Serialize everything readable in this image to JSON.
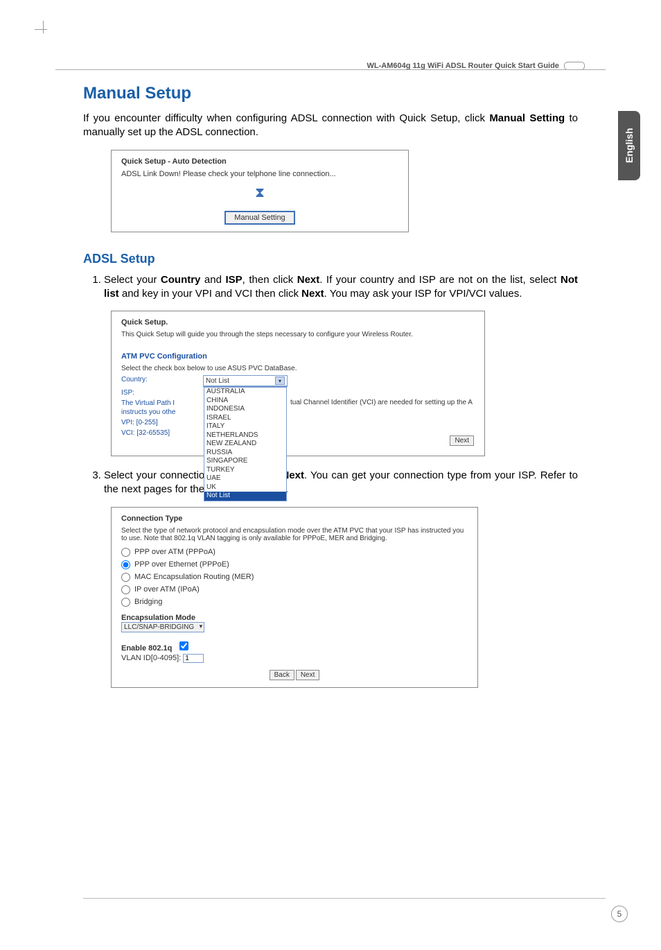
{
  "header": {
    "title": "WL-AM604g 11g WiFi ADSL Router Quick Start Guide"
  },
  "side_tab": "English",
  "section": {
    "title": "Manual Setup",
    "intro_prefix": "If you encounter difficulty when configuring ADSL connection with Quick Setup, click ",
    "intro_bold": "Manual Setting",
    "intro_suffix": " to manually set up the ADSL connection."
  },
  "shot1": {
    "title": "Quick Setup - Auto Detection",
    "msg": "ADSL Link Down! Please check your telphone line connection...",
    "button": "Manual Setting"
  },
  "adsl": {
    "title": "ADSL Setup"
  },
  "step1": {
    "p1": "Select your ",
    "b1": "Country",
    "p2": " and ",
    "b2": "ISP",
    "p3": ", then click ",
    "b3": "Next",
    "p4": ". If your country and ISP are not on the list, select ",
    "b4": "Not list",
    "p5": " and key in your VPI and VCI then click ",
    "b5": "Next",
    "p6": ". You may ask your ISP for VPI/VCI values."
  },
  "shot2": {
    "title": "Quick Setup.",
    "desc": "This Quick Setup will guide you through the steps necessary to configure your Wireless Router.",
    "atm_title": "ATM PVC Configuration",
    "atm_desc": "Select the check box below to use ASUS PVC DataBase.",
    "row_country": "Country:",
    "row_isp": "ISP:",
    "vp_text_left": "The Virtual Path I\ninstructs you othe",
    "vp_text_right": "tual Channel Identifier (VCI) are needed for setting up the A",
    "row_vpi": "VPI: [0-255]",
    "row_vci": "VCI: [32-65535]",
    "dropdown_selected": "Not List",
    "dropdown_options": [
      "AUSTRALIA",
      "CHINA",
      "INDONESIA",
      "ISRAEL",
      "ITALY",
      "NETHERLANDS",
      "NEW ZEALAND",
      "RUSSIA",
      "SINGAPORE",
      "TURKEY",
      "UAE",
      "UK",
      "Not List"
    ],
    "next": "Next"
  },
  "step3": {
    "p1": "Select your connection type and click ",
    "b1": "Next",
    "p2": ". You can get your connection type from your ISP. Refer to the next pages for the connection types."
  },
  "shot3": {
    "title": "Connection Type",
    "desc": "Select the type of network protocol and encapsulation mode over the ATM PVC that your ISP has instructed you to use. Note that 802.1q VLAN tagging is only available for PPPoE, MER and Bridging.",
    "opt_pppoa": "PPP over ATM (PPPoA)",
    "opt_pppoe": "PPP over Ethernet (PPPoE)",
    "opt_mer": "MAC Encapsulation Routing (MER)",
    "opt_ipoa": "IP over ATM (IPoA)",
    "opt_bridging": "Bridging",
    "encap_title": "Encapsulation Mode",
    "encap_value": "LLC/SNAP-BRIDGING",
    "enable_label": "Enable 802.1q",
    "vlan_label": "VLAN ID[0-4095]:",
    "vlan_value": "1",
    "back": "Back",
    "next": "Next"
  },
  "page_number": "5"
}
